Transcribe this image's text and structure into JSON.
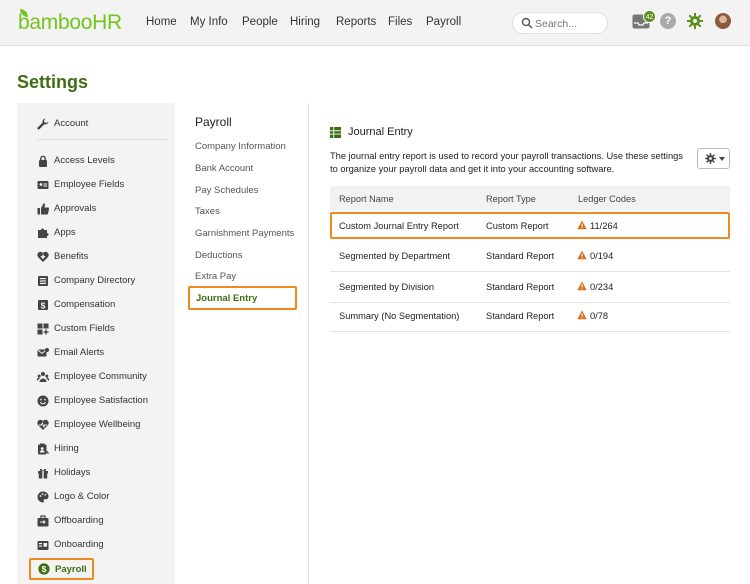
{
  "brand": {
    "logo_text": "bambooHR",
    "accent": "#73c41d",
    "title_color": "#3e6d12",
    "highlight": "#f0891f"
  },
  "topnav": {
    "items": [
      "Home",
      "My Info",
      "People",
      "Hiring",
      "Reports",
      "Files",
      "Payroll"
    ],
    "search_placeholder": "Search...",
    "inbox_count": "42",
    "help_label": "?",
    "icons": [
      "search-icon",
      "inbox-icon",
      "help-icon",
      "gear-icon",
      "avatar"
    ]
  },
  "page": {
    "title": "Settings"
  },
  "sidebar": {
    "items": [
      {
        "label": "Account",
        "icon": "wrench-icon"
      },
      {
        "label": "Access Levels",
        "icon": "lock-icon"
      },
      {
        "label": "Employee Fields",
        "icon": "id-card-icon"
      },
      {
        "label": "Approvals",
        "icon": "thumbs-up-icon"
      },
      {
        "label": "Apps",
        "icon": "puzzle-icon"
      },
      {
        "label": "Benefits",
        "icon": "heart-plus-icon"
      },
      {
        "label": "Company Directory",
        "icon": "directory-icon"
      },
      {
        "label": "Compensation",
        "icon": "dollar-icon"
      },
      {
        "label": "Custom Fields",
        "icon": "custom-fields-icon"
      },
      {
        "label": "Email Alerts",
        "icon": "email-alert-icon"
      },
      {
        "label": "Employee Community",
        "icon": "community-icon"
      },
      {
        "label": "Employee Satisfaction",
        "icon": "smiley-icon"
      },
      {
        "label": "Employee Wellbeing",
        "icon": "wellbeing-icon"
      },
      {
        "label": "Hiring",
        "icon": "hiring-icon"
      },
      {
        "label": "Holidays",
        "icon": "gift-icon"
      },
      {
        "label": "Logo & Color",
        "icon": "palette-icon"
      },
      {
        "label": "Offboarding",
        "icon": "offboarding-icon"
      },
      {
        "label": "Onboarding",
        "icon": "onboarding-icon"
      },
      {
        "label": "Payroll",
        "icon": "payroll-dollar-icon",
        "active": true
      }
    ]
  },
  "subnav": {
    "title": "Payroll",
    "items": [
      "Company Information",
      "Bank Account",
      "Pay Schedules",
      "Taxes",
      "Garnishment Payments",
      "Deductions",
      "Extra Pay",
      "Journal Entry"
    ],
    "active": "Journal Entry"
  },
  "content": {
    "title": "Journal Entry",
    "description": "The journal entry report is used to record your payroll transactions. Use these settings to organize your payroll data and get it into your accounting software.",
    "settings_button_icon": "gear-icon",
    "table": {
      "headers": [
        "Report Name",
        "Report Type",
        "Ledger Codes"
      ],
      "rows": [
        {
          "name": "Custom Journal Entry Report",
          "type": "Custom Report",
          "ledger": "11/264",
          "highlight": true
        },
        {
          "name": "Segmented by Department",
          "type": "Standard Report",
          "ledger": "0/194"
        },
        {
          "name": "Segmented by Division",
          "type": "Standard Report",
          "ledger": "0/234"
        },
        {
          "name": "Summary (No Segmentation)",
          "type": "Standard Report",
          "ledger": "0/78"
        }
      ],
      "warning_icon": "warning-icon",
      "warning_color": "#d4731c"
    }
  }
}
